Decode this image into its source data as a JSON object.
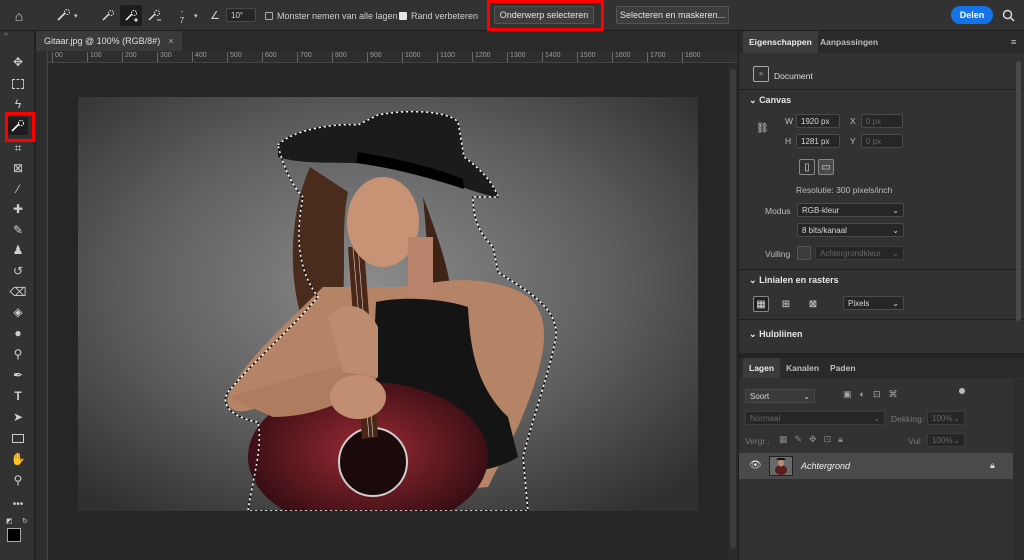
{
  "optionsbar": {
    "angle": "10°",
    "brush_size_top": "-",
    "brush_size": "7",
    "sample_all_layers": "Monster nemen van alle lagen",
    "refine_edge": "Rand verbeteren",
    "select_subject": "Onderwerp selecteren",
    "select_and_mask": "Selecteren en maskeren...",
    "share": "Delen"
  },
  "document": {
    "tab": "Gitaar.jpg @ 100% (RGB/8#)",
    "ruler_marks": [
      "00",
      "100",
      "200",
      "300",
      "400",
      "500",
      "600",
      "700",
      "800",
      "900",
      "1000",
      "1100",
      "1200",
      "1300",
      "1400",
      "1500",
      "1600",
      "1700",
      "1800"
    ]
  },
  "properties": {
    "tab_properties": "Eigenschappen",
    "tab_adjustments": "Aanpassingen",
    "document_label": "Document",
    "canvas_title": "Canvas",
    "w_label": "W",
    "h_label": "H",
    "x_label": "X",
    "y_label": "Y",
    "width": "1920 px",
    "height": "1281 px",
    "x_placeholder": "0 px",
    "y_placeholder": "0 px",
    "resolution": "Resolutie: 300 pixels/inch",
    "mode_label": "Modus",
    "mode": "RGB-kleur",
    "bits": "8 bits/kanaal",
    "fill_label": "Vulling",
    "fill": "Achtergrondkleur",
    "rulers_title": "Linialen en rasters",
    "ruler_units": "Pixels",
    "guides_title": "Hulplijnen"
  },
  "layers": {
    "tab_layers": "Lagen",
    "tab_channels": "Kanalen",
    "tab_paths": "Paden",
    "search": "Soort",
    "blend": "Normaal",
    "opacity_label": "Dekking:",
    "opacity": "100%",
    "lock_label": "Vergr.:",
    "fill_label": "Vul:",
    "fill": "100%",
    "layer_name": "Achtergrond"
  },
  "colors": {
    "accent": "#1473e6",
    "highlight": "#ff0000"
  }
}
